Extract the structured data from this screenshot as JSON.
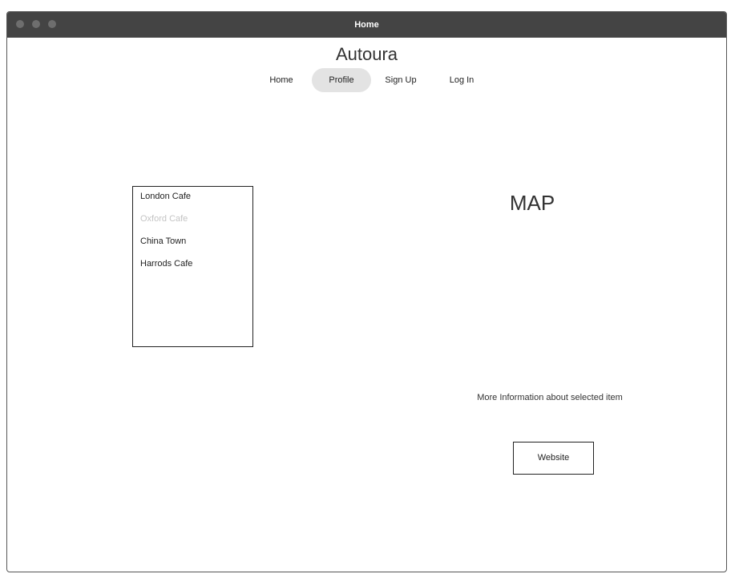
{
  "window": {
    "title": "Home"
  },
  "header": {
    "brand": "Autoura"
  },
  "nav": {
    "items": [
      {
        "label": "Home"
      },
      {
        "label": "Profile",
        "active": true
      },
      {
        "label": "Sign Up"
      },
      {
        "label": "Log In"
      }
    ]
  },
  "list": {
    "items": [
      {
        "label": "London Cafe"
      },
      {
        "label": "Oxford Cafe",
        "state": "disabled"
      },
      {
        "label": "China Town"
      },
      {
        "label": "Harrods Cafe"
      }
    ]
  },
  "map": {
    "label": "MAP"
  },
  "details": {
    "info_text": "More Information about selected item",
    "website_label": "Website"
  },
  "colors": {
    "titlebar": "#444444",
    "nav_active_bg": "#e3e3e3",
    "muted_text": "#c4c4c4",
    "border": "#222222"
  }
}
